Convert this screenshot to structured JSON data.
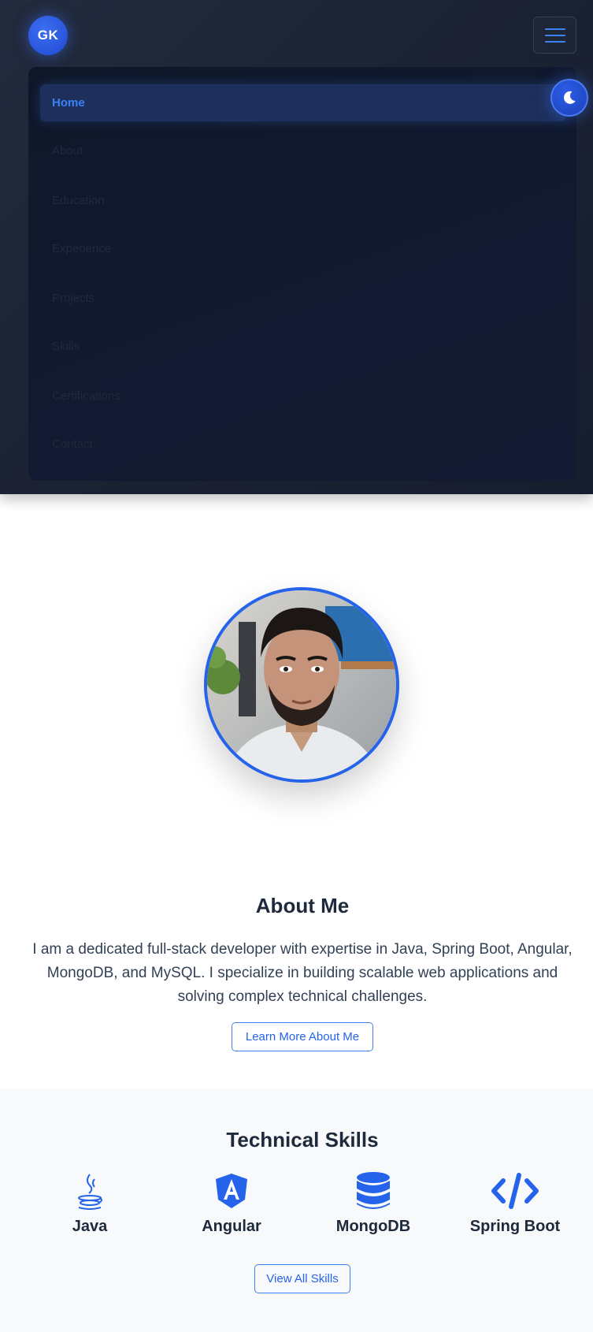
{
  "header": {
    "logo_text": "GK",
    "menu_icon": "hamburger-icon",
    "theme_icon": "moon-icon"
  },
  "nav": {
    "items": [
      {
        "label": "Home",
        "active": true
      },
      {
        "label": "About"
      },
      {
        "label": "Education"
      },
      {
        "label": "Experience"
      },
      {
        "label": "Projects"
      },
      {
        "label": "Skills"
      },
      {
        "label": "Certifications"
      },
      {
        "label": "Contact"
      }
    ]
  },
  "profile": {
    "image": "profile-photo"
  },
  "about": {
    "title": "About Me",
    "text": "I am a dedicated full-stack developer with expertise in Java, Spring Boot, Angular, MongoDB, and MySQL. I specialize in building scalable web applications and solving complex technical challenges.",
    "button": "Learn More About Me"
  },
  "skills": {
    "title": "Technical Skills",
    "items": [
      {
        "label": "Java",
        "icon": "java-icon"
      },
      {
        "label": "Angular",
        "icon": "angular-icon"
      },
      {
        "label": "MongoDB",
        "icon": "database-icon"
      },
      {
        "label": "Spring Boot",
        "icon": "code-icon"
      }
    ],
    "button": "View All Skills"
  },
  "colors": {
    "accent": "#2563eb",
    "nav_bg": "#0f172a",
    "header_bg": "#1b2233",
    "skills_bg": "#f8f9fa"
  }
}
